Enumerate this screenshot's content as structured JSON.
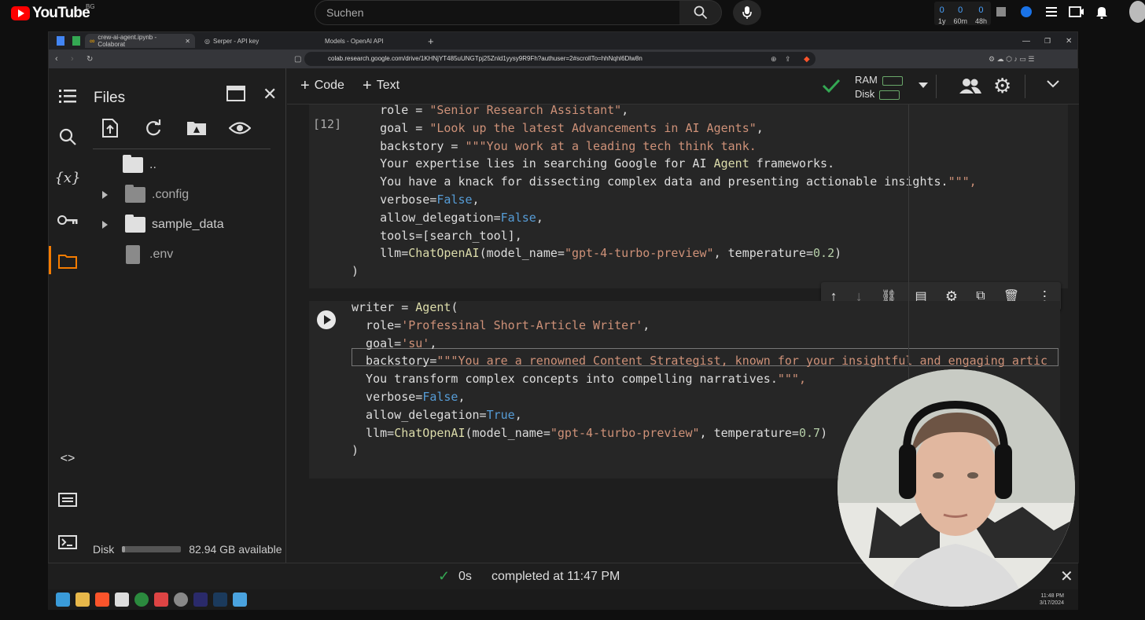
{
  "youtube": {
    "logo_text": "YouTube",
    "country": "BG",
    "search_placeholder": "Suchen",
    "stats": [
      {
        "value": "0",
        "label": "1y"
      },
      {
        "value": "0",
        "label": "60m"
      },
      {
        "value": "0",
        "label": "48h"
      }
    ]
  },
  "browser": {
    "tabs": [
      {
        "label": "crew-ai-agent.ipynb - Colaborat"
      },
      {
        "label": "Serper - API key"
      },
      {
        "label": "Models - OpenAI API"
      }
    ],
    "url": "colab.research.google.com/drive/1KHNjYT485uUNGTpj25Znld1yysy9R9Fh?authuser=2#scrollTo=hhNqhl6Dlw8n"
  },
  "files_panel": {
    "title": "Files",
    "items": [
      {
        "name": ".."
      },
      {
        "name": ".config"
      },
      {
        "name": "sample_data"
      },
      {
        "name": ".env"
      }
    ],
    "disk_label": "Disk",
    "disk_available": "82.94 GB available",
    "disk_used_fraction": 0.05
  },
  "toolbar": {
    "code_label": "Code",
    "text_label": "Text",
    "ram_label": "RAM",
    "disk_label": "Disk"
  },
  "cell1": {
    "exec_count": "[12]",
    "lines": [
      "    role = \"Senior Research Assistant\",",
      "    goal = \"Look up the latest Advancements in AI Agents\",",
      "    backstory = \"\"\"You work at a leading tech think tank.",
      "    Your expertise lies in searching Google for AI Agent frameworks.",
      "    You have a knack for dissecting complex data and presenting actionable insights.\"\"\",",
      "    verbose=False,",
      "    allow_delegation=False,",
      "    tools=[search_tool],",
      "    llm=ChatOpenAI(model_name=\"gpt-4-turbo-preview\", temperature=0.2)",
      ")"
    ]
  },
  "cell2": {
    "lines": [
      "writer = Agent(",
      "  role='Professinal Short-Article Writer',",
      "  goal='su',",
      "  backstory=\"\"\"You are a renowned Content Strategist, known for your insightful and engaging artic",
      "  You transform complex concepts into compelling narratives.\"\"\",",
      "  verbose=False,",
      "  allow_delegation=True,",
      "  llm=ChatOpenAI(model_name=\"gpt-4-turbo-preview\", temperature=0.7)",
      ")"
    ]
  },
  "status": {
    "duration": "0s",
    "completed_text": "completed at 11:47 PM"
  },
  "taskbar": {
    "time": "11:48 PM",
    "date": "3/17/2024"
  },
  "colors": {
    "accent_check": "#34a853",
    "youtube_red": "#ff0000"
  }
}
